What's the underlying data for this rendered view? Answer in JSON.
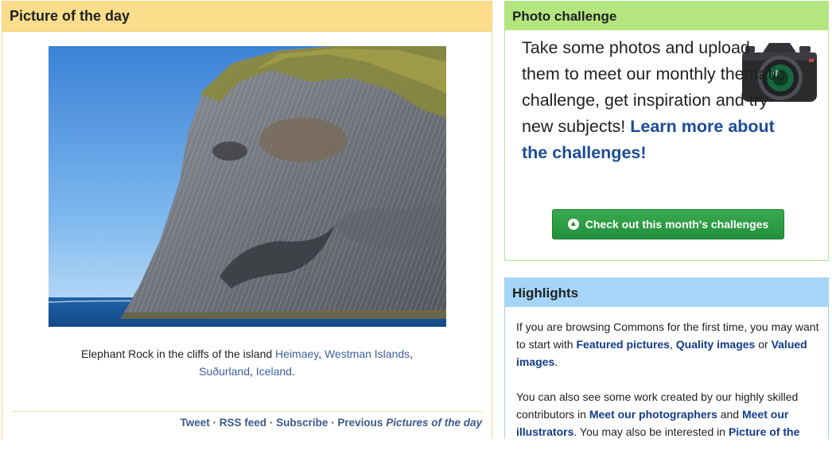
{
  "potd": {
    "header": "Picture of the day",
    "caption_prefix": "Elephant Rock in the cliffs of the island",
    "caption_links": [
      "Heimaey",
      "Westman Islands",
      "Suðurland",
      "Iceland"
    ],
    "caption_suffix": ".",
    "footer": {
      "tweet": "Tweet",
      "rss": "RSS feed",
      "subscribe": "Subscribe",
      "previous_prefix": "Previous",
      "previous_italic": "Pictures of the day",
      "separator": "·"
    }
  },
  "challenge": {
    "header": "Photo challenge",
    "text": "Take some photos and upload them to meet our monthly thematic challenge, get inspiration and try new subjects!",
    "link": "Learn more about the challenges!",
    "button_label": "Check out this month's challenges",
    "button_icon": "arrow-up-circle-icon",
    "accent": "#2ba047"
  },
  "highlights": {
    "header": "Highlights",
    "p1_text1": "If you are browsing Commons for the first time, you may want to start with",
    "p1_link1": "Featured pictures",
    "p1_text2": ",",
    "p1_link2": "Quality images",
    "p1_text3": "or",
    "p1_link3": "Valued images",
    "p1_text4": ".",
    "p2_text1": "You can also see some work created by our highly skilled contributors in",
    "p2_link1": "Meet our photographers",
    "p2_text2": "and",
    "p2_link2": "Meet our illustrators",
    "p2_text3": ". You may also be interested in",
    "p2_link3": "Picture of the"
  }
}
